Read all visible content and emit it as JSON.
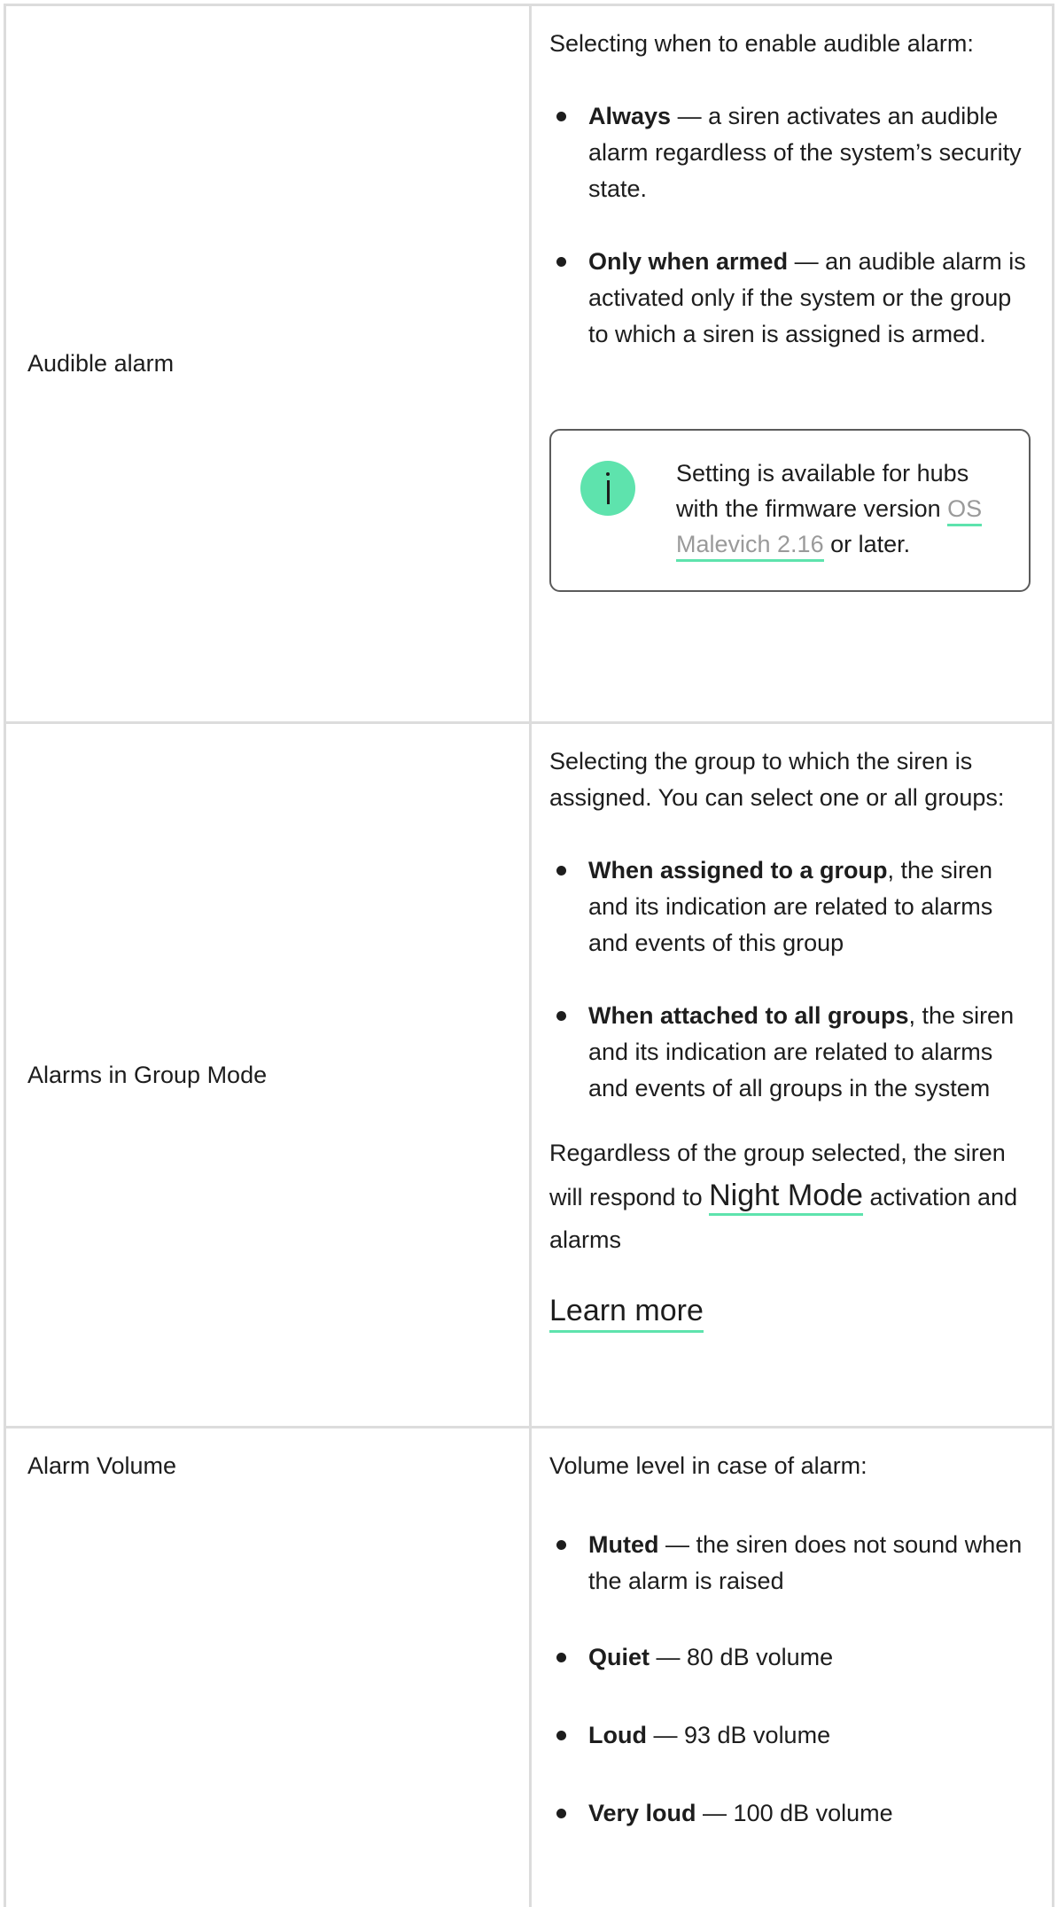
{
  "rows": [
    {
      "label": "Audible alarm",
      "intro": "Selecting when to enable audible alarm:",
      "items": [
        {
          "term": "Always",
          "text": " — a siren activates an audible alarm regardless of the system’s security state."
        },
        {
          "term": "Only when armed",
          "text": " — an audible alarm is activated only if the system or the group to which a siren is assigned is armed."
        }
      ],
      "info": {
        "text_before": "Setting is available for hubs with the firmware version ",
        "link": "OS Malevich 2.16",
        "text_after": " or later."
      }
    },
    {
      "label": "Alarms in Group Mode",
      "intro": "Selecting the group to which the siren is assigned. You can select one or all groups:",
      "items": [
        {
          "term": "When assigned to a group",
          "text": ", the siren and its indication are related to alarms and events of this group"
        },
        {
          "term": "When attached to all groups",
          "text": ", the siren and its indication are related to alarms and events of all groups in the system"
        }
      ],
      "note_before": "Regardless of the group selected, the siren will respond to ",
      "note_link": "Night Mode",
      "note_after": " activation and alarms",
      "learn_more": "Learn more"
    },
    {
      "label": "Alarm Volume",
      "intro": "Volume level in case of alarm:",
      "items": [
        {
          "term": "Muted",
          "text": " — the siren does not sound when the alarm is raised"
        },
        {
          "term": "Quiet",
          "text": " — 80 dB volume"
        },
        {
          "term": "Loud",
          "text": " — 93 dB volume"
        },
        {
          "term": "Very loud",
          "text": " — 100 dB volume"
        }
      ]
    }
  ],
  "colors": {
    "accent": "#5ee3ad",
    "border": "#dcdcdc",
    "text": "#1d1d1d",
    "link_grey": "#9a9a9a"
  }
}
